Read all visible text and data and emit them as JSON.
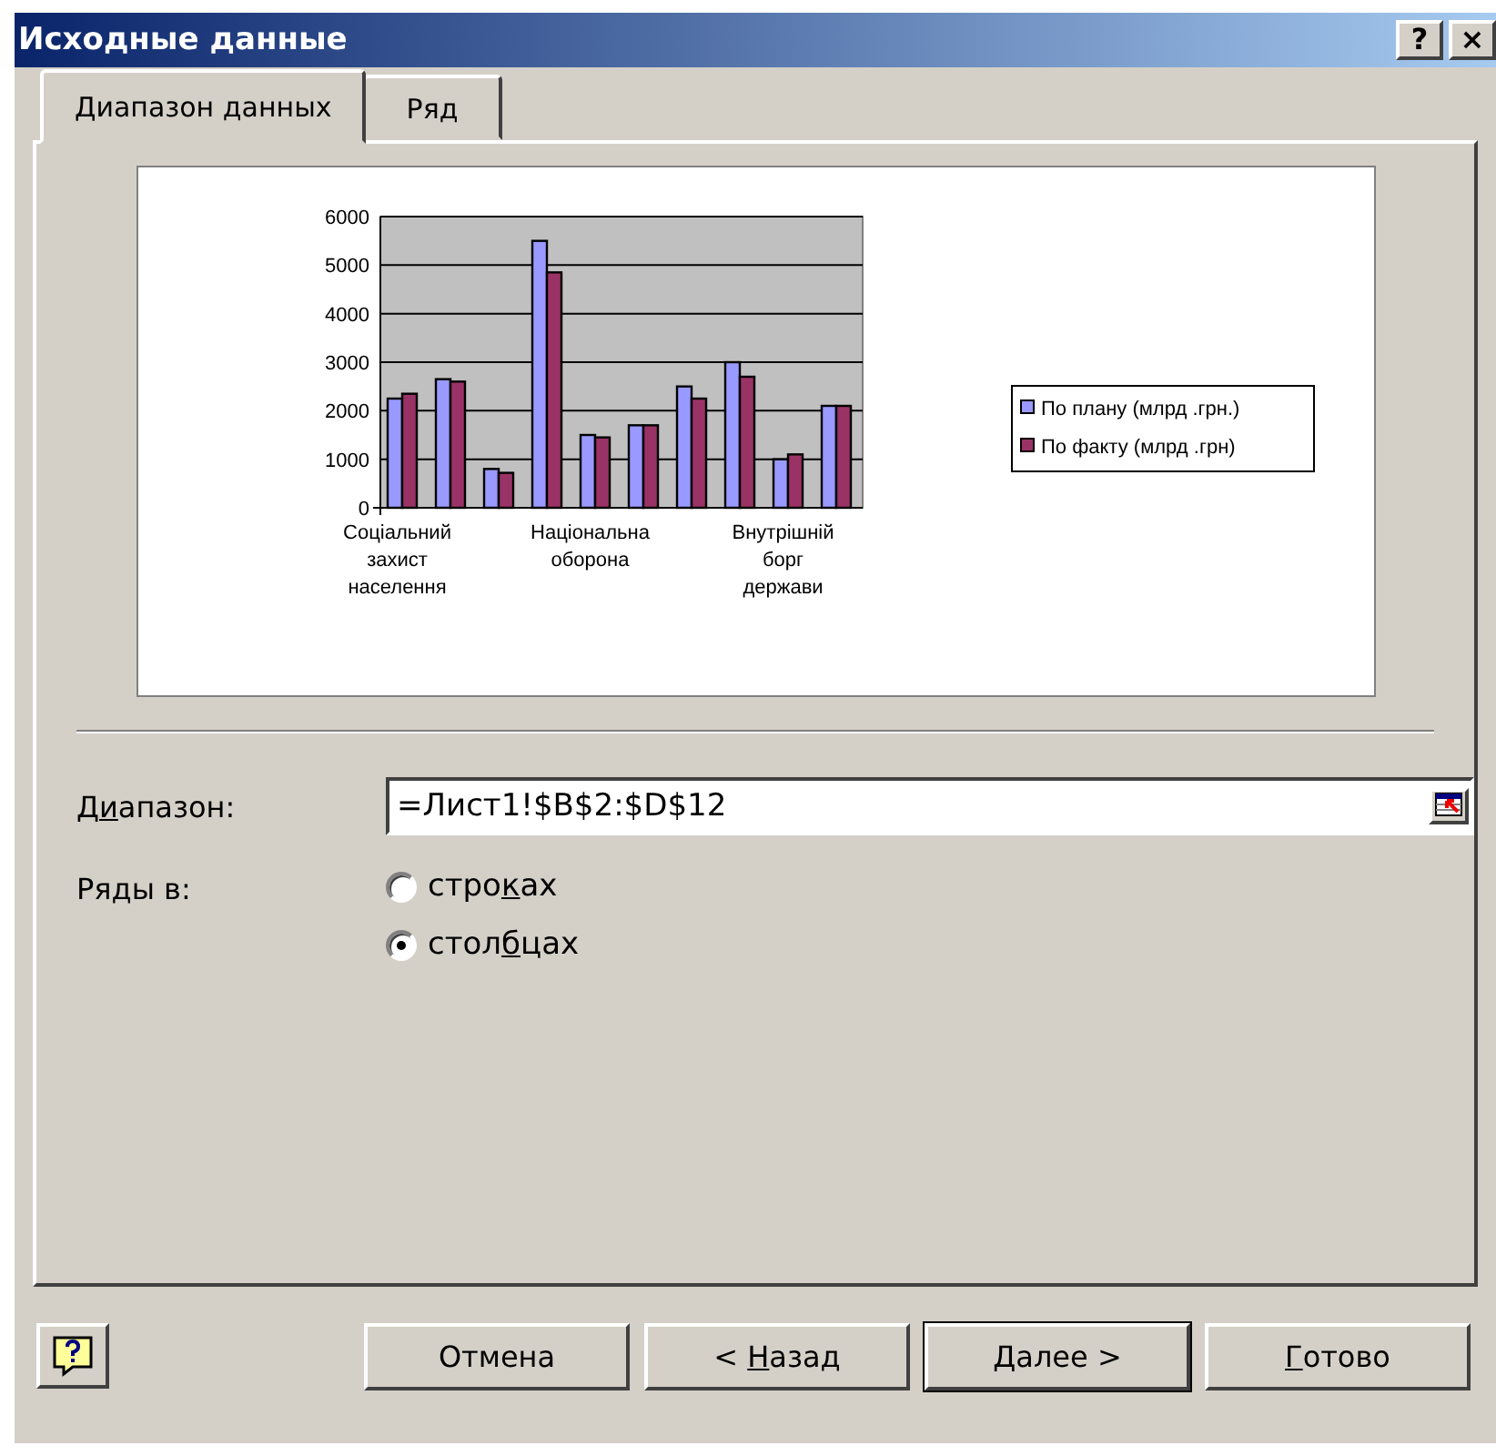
{
  "window": {
    "title": "Исходные данные",
    "help_button": "?",
    "close_button": "×"
  },
  "tabs": [
    {
      "label": "Диапазон данных",
      "selected": true
    },
    {
      "label": "Ряд",
      "selected": false
    }
  ],
  "preview": {
    "chart_data": {
      "type": "bar",
      "categories": [
        "Соціальний захист населення",
        null,
        null,
        null,
        "Національна оборона",
        null,
        null,
        null,
        "Внутрішній борг держави",
        null
      ],
      "series": [
        {
          "name": "По плану (млрд .грн.)",
          "color": "#9999ff",
          "values": [
            2250,
            2650,
            800,
            5500,
            1500,
            1700,
            2500,
            3000,
            1000,
            2100
          ]
        },
        {
          "name": "По факту (млрд .грн)",
          "color": "#993366",
          "values": [
            2350,
            2600,
            720,
            4850,
            1450,
            1700,
            2250,
            2700,
            1100,
            2100
          ]
        }
      ],
      "ylim": [
        0,
        6000
      ],
      "grid": true,
      "legend": true,
      "yticks": [
        0,
        1000,
        2000,
        3000,
        4000,
        5000,
        6000
      ]
    }
  },
  "range": {
    "label": {
      "before": "Д",
      "access_key": "и",
      "after": "апазон:"
    },
    "value": "=Лист1!$B$2:$D$12"
  },
  "series_in": {
    "label": "Ряды в:",
    "options": [
      {
        "before": "стро",
        "access_key": "к",
        "after": "ах",
        "selected": false
      },
      {
        "before": "стол",
        "access_key": "б",
        "after": "цах",
        "selected": true
      }
    ]
  },
  "buttons": [
    {
      "before": "Отмена",
      "default": false
    },
    {
      "before": "< ",
      "access_key": "Н",
      "after": "азад",
      "default": false
    },
    {
      "before": "Далее >",
      "default": true
    },
    {
      "access_key": "Г",
      "after": "отово",
      "default": false
    }
  ]
}
